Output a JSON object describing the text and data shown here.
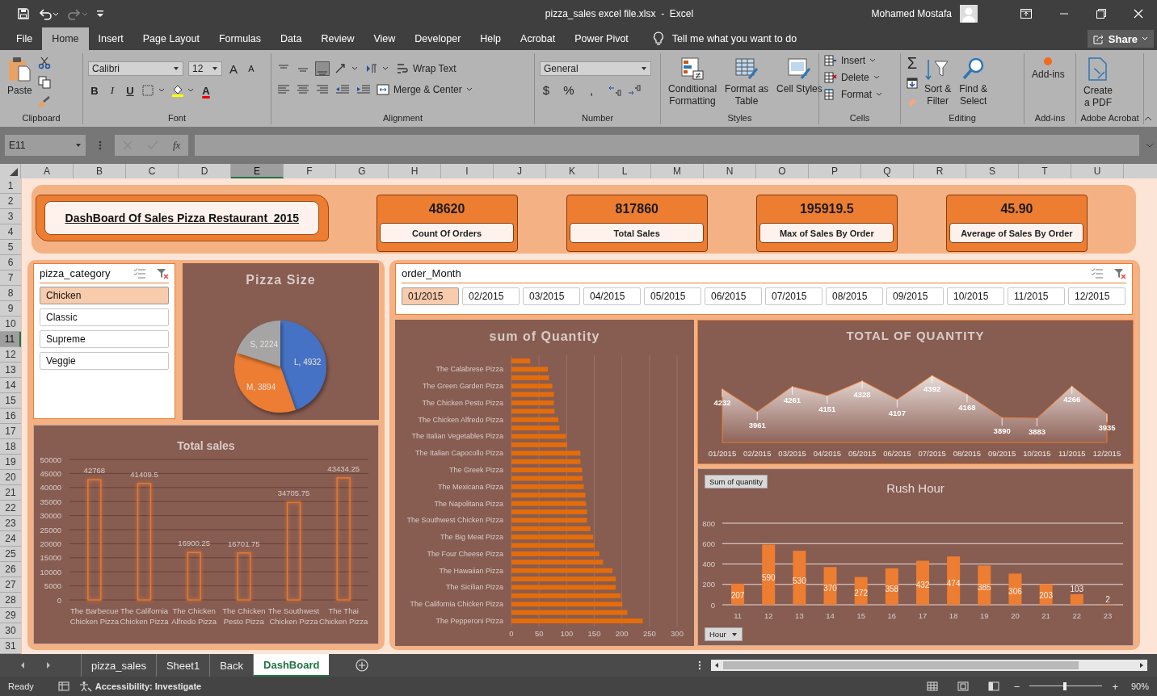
{
  "title_bar": {
    "title": "pizza_sales excel file.xlsx  -  Excel",
    "user": "Mohamed Mostafa"
  },
  "menu_tabs": [
    {
      "label": "File",
      "selected": false
    },
    {
      "label": "Home",
      "selected": true
    },
    {
      "label": "Insert",
      "selected": false
    },
    {
      "label": "Page Layout",
      "selected": false
    },
    {
      "label": "Formulas",
      "selected": false
    },
    {
      "label": "Data",
      "selected": false
    },
    {
      "label": "Review",
      "selected": false
    },
    {
      "label": "View",
      "selected": false
    },
    {
      "label": "Developer",
      "selected": false
    },
    {
      "label": "Help",
      "selected": false
    },
    {
      "label": "Acrobat",
      "selected": false
    },
    {
      "label": "Power Pivot",
      "selected": false
    }
  ],
  "tell_me": "Tell me what you want to do",
  "share_button": "Share",
  "ribbon": {
    "groups": [
      {
        "kind": "clipboard",
        "label": "Clipboard",
        "paste": "Paste"
      },
      {
        "kind": "font",
        "label": "Font",
        "font_name": "Calibri",
        "font_size": "12",
        "grow": "A",
        "shrink": "A",
        "bold": "B",
        "italic": "I",
        "underline": "U",
        "font_color": "A"
      },
      {
        "kind": "alignment",
        "label": "Alignment",
        "wrap_text": "Wrap Text",
        "merge": "Merge & Center",
        "vertical_align": [
          {
            "selected": false
          },
          {
            "selected": false
          },
          {
            "selected": true
          }
        ]
      },
      {
        "kind": "number",
        "label": "Number",
        "format": "General",
        "currency": "$",
        "percent": "%",
        "comma": ","
      },
      {
        "kind": "styles",
        "label": "Styles",
        "items": [
          "Conditional Formatting",
          "Format as Table",
          "Cell Styles"
        ]
      },
      {
        "kind": "cells",
        "label": "Cells",
        "items": [
          "Insert",
          "Delete",
          "Format"
        ]
      },
      {
        "kind": "editing",
        "label": "Editing",
        "autosum": "Σ",
        "items": [
          "Sort & Filter",
          "Find & Select"
        ]
      },
      {
        "kind": "addins",
        "label": "Add-ins",
        "items": [
          "Add-ins"
        ]
      },
      {
        "kind": "acrobat",
        "label": "Adobe Acrobat",
        "items": [
          "Create a PDF"
        ]
      }
    ]
  },
  "formula_bar": {
    "name_box": "E11",
    "function_label": "fx"
  },
  "columns": [
    {
      "label": "A",
      "selected": false
    },
    {
      "label": "B",
      "selected": false
    },
    {
      "label": "C",
      "selected": false
    },
    {
      "label": "D",
      "selected": false
    },
    {
      "label": "E",
      "selected": true
    },
    {
      "label": "F",
      "selected": false
    },
    {
      "label": "G",
      "selected": false
    },
    {
      "label": "H",
      "selected": false
    },
    {
      "label": "I",
      "selected": false
    },
    {
      "label": "J",
      "selected": false
    },
    {
      "label": "K",
      "selected": false
    },
    {
      "label": "L",
      "selected": false
    },
    {
      "label": "M",
      "selected": false
    },
    {
      "label": "N",
      "selected": false
    },
    {
      "label": "O",
      "selected": false
    },
    {
      "label": "P",
      "selected": false
    },
    {
      "label": "Q",
      "selected": false
    },
    {
      "label": "R",
      "selected": false
    },
    {
      "label": "S",
      "selected": false
    },
    {
      "label": "T",
      "selected": false
    },
    {
      "label": "U",
      "selected": false
    }
  ],
  "rows": [
    {
      "label": "1",
      "selected": false
    },
    {
      "label": "2",
      "selected": false
    },
    {
      "label": "3",
      "selected": false
    },
    {
      "label": "4",
      "selected": false
    },
    {
      "label": "5",
      "selected": false
    },
    {
      "label": "6",
      "selected": false
    },
    {
      "label": "7",
      "selected": false
    },
    {
      "label": "8",
      "selected": false
    },
    {
      "label": "9",
      "selected": false
    },
    {
      "label": "10",
      "selected": false
    },
    {
      "label": "11",
      "selected": true
    },
    {
      "label": "12",
      "selected": false
    },
    {
      "label": "13",
      "selected": false
    },
    {
      "label": "14",
      "selected": false
    },
    {
      "label": "15",
      "selected": false
    },
    {
      "label": "16",
      "selected": false
    },
    {
      "label": "17",
      "selected": false
    },
    {
      "label": "18",
      "selected": false
    },
    {
      "label": "19",
      "selected": false
    },
    {
      "label": "20",
      "selected": false
    },
    {
      "label": "21",
      "selected": false
    },
    {
      "label": "22",
      "selected": false
    },
    {
      "label": "23",
      "selected": false
    },
    {
      "label": "24",
      "selected": false
    },
    {
      "label": "25",
      "selected": false
    },
    {
      "label": "26",
      "selected": false
    },
    {
      "label": "27",
      "selected": false
    },
    {
      "label": "28",
      "selected": false
    },
    {
      "label": "29",
      "selected": false
    },
    {
      "label": "30",
      "selected": false
    },
    {
      "label": "31",
      "selected": false
    }
  ],
  "dashboard": {
    "title": "DashBoard Of Sales Pizza Restaurant  2015",
    "kpis": [
      {
        "value": "48620",
        "label": "Count Of Orders"
      },
      {
        "value": "817860",
        "label": "Total Sales"
      },
      {
        "value": "195919.5",
        "label": "Max of Sales By Order"
      },
      {
        "value": "45.90",
        "label": "Average of Sales By Order"
      }
    ],
    "category_slicer": {
      "title": "pizza_category",
      "items": [
        {
          "label": "Chicken",
          "selected": true
        },
        {
          "label": "Classic",
          "selected": false
        },
        {
          "label": "Supreme",
          "selected": false
        },
        {
          "label": "Veggie",
          "selected": false
        }
      ]
    },
    "month_slicer": {
      "title": "order_Month",
      "items": [
        {
          "label": "01/2015",
          "selected": true
        },
        {
          "label": "02/2015",
          "selected": false
        },
        {
          "label": "03/2015",
          "selected": false
        },
        {
          "label": "04/2015",
          "selected": false
        },
        {
          "label": "05/2015",
          "selected": false
        },
        {
          "label": "06/2015",
          "selected": false
        },
        {
          "label": "07/2015",
          "selected": false
        },
        {
          "label": "08/2015",
          "selected": false
        },
        {
          "label": "09/2015",
          "selected": false
        },
        {
          "label": "10/2015",
          "selected": false
        },
        {
          "label": "11/2015",
          "selected": false
        },
        {
          "label": "12/2015",
          "selected": false
        }
      ]
    },
    "pizza_size": {
      "chart_data": {
        "type": "pie",
        "title": "Pizza Size",
        "values": [
          4932,
          3894,
          2224
        ],
        "value_labels": [
          "L, 4932",
          "M, 3894",
          "S, 2224"
        ]
      }
    },
    "total_sales": {
      "chart_data": {
        "type": "bar",
        "title": "Total sales",
        "categories": [
          "The Barbecue Chicken Pizza",
          "The California Chicken Pizza",
          "The Chicken Alfredo Pizza",
          "The Chicken Pesto Pizza",
          "The Southwest Chicken Pizza",
          "The Thai Chicken Pizza"
        ],
        "values": [
          42768,
          41409.5,
          16900.25,
          16701.75,
          34705.75,
          43434.25
        ],
        "ylim": [
          0,
          50000
        ],
        "yticks": [
          0,
          5000,
          10000,
          15000,
          20000,
          25000,
          30000,
          35000,
          40000,
          45000,
          50000
        ],
        "grid": true,
        "data_labels": true
      }
    },
    "sum_of_quantity": {
      "chart_data": {
        "type": "bar",
        "orientation": "horizontal",
        "title": "sum of Quantity",
        "categories": [
          null,
          "The Calabrese Pizza",
          null,
          "The Green Garden Pizza",
          null,
          "The Chicken Pesto Pizza",
          null,
          "The Chicken Alfredo Pizza",
          null,
          "The Italian Vegetables Pizza",
          null,
          "The Italian Capocollo Pizza",
          null,
          "The Greek Pizza",
          null,
          "The Mexicana Pizza",
          null,
          "The Napolitana Pizza",
          null,
          "The Southwest Chicken Pizza",
          null,
          "The Big Meat Pizza",
          null,
          "The Four Cheese Pizza",
          null,
          "The Hawaiian Pizza",
          null,
          "The Sicilian Pizza",
          null,
          "The California Chicken Pizza",
          null,
          "The Pepperoni Pizza"
        ],
        "values": [
          34,
          66,
          68,
          74,
          77,
          77,
          78,
          85,
          87,
          99,
          101,
          125,
          125,
          128,
          129,
          131,
          134,
          135,
          137,
          137,
          143,
          148,
          151,
          159,
          166,
          183,
          189,
          189,
          198,
          201,
          210,
          238
        ],
        "xlim": [
          0,
          300
        ],
        "xticks": [
          0,
          50,
          100,
          150,
          200,
          250,
          300
        ],
        "grid": true
      }
    },
    "total_of_quantity": {
      "chart_data": {
        "type": "area",
        "title": "TOTAL OF QUANTITY",
        "categories": [
          "01/2015",
          "02/2015",
          "03/2015",
          "04/2015",
          "05/2015",
          "06/2015",
          "07/2015",
          "08/2015",
          "09/2015",
          "10/2015",
          "11/2015",
          "12/2015"
        ],
        "values": [
          4232,
          3961,
          4261,
          4151,
          4328,
          4107,
          4392,
          4168,
          3890,
          3883,
          4266,
          3935
        ],
        "data_labels": true
      }
    },
    "rush_hour": {
      "value_button": "Sum of quantity",
      "axis_button": "Hour",
      "chart_data": {
        "type": "bar",
        "title": "Rush Hour",
        "categories": [
          "11",
          "12",
          "13",
          "14",
          "15",
          "16",
          "17",
          "18",
          "19",
          "20",
          "21",
          "22",
          "23"
        ],
        "values": [
          207,
          590,
          530,
          370,
          272,
          358,
          432,
          474,
          385,
          306,
          203,
          103,
          2
        ],
        "ylim": [
          0,
          800
        ],
        "yticks": [
          0,
          200,
          400,
          600,
          800
        ],
        "grid": true,
        "data_labels": true
      }
    }
  },
  "sheet_tabs": [
    {
      "label": "pizza_sales",
      "selected": false
    },
    {
      "label": "Sheet1",
      "selected": false
    },
    {
      "label": "Back",
      "selected": false
    },
    {
      "label": "DashBoard",
      "selected": true
    }
  ],
  "status_bar": {
    "ready": "Ready",
    "accessibility": "Accessibility: Investigate",
    "zoom_out": "−",
    "zoom_in": "+",
    "zoom": "90%",
    "zoom_slider": {
      "level": 0.48
    }
  }
}
